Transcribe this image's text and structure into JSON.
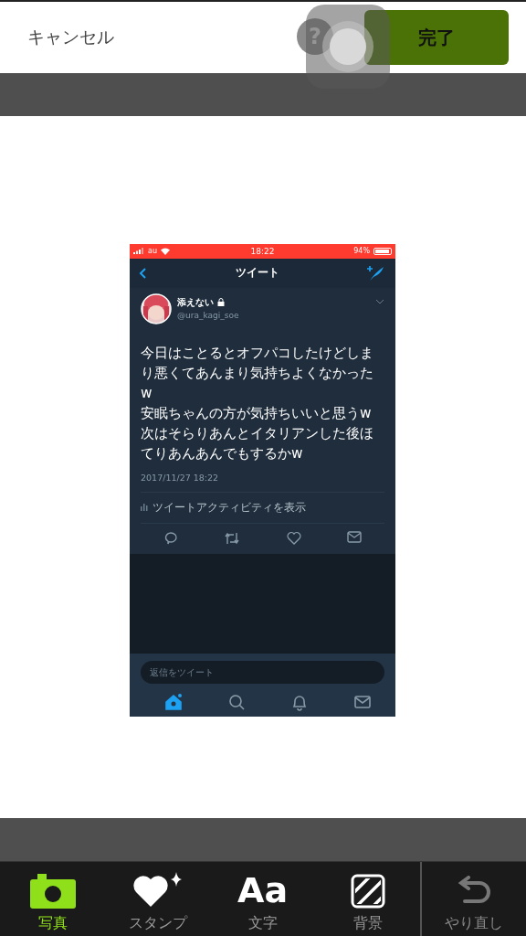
{
  "top_bar": {
    "cancel": "キャンセル",
    "help": "?",
    "done": "完了"
  },
  "screenshot": {
    "status_bar": {
      "carrier": "au",
      "time": "18:22",
      "battery": "94%"
    },
    "nav": {
      "title": "ツイート"
    },
    "tweet": {
      "name": "添えない",
      "locked": true,
      "handle": "@ura_kagi_soe",
      "text": "今日はことるとオフパコしたけどしまり悪くてあんまり気持ちよくなかったw\n安眠ちゃんの方が気持ちいいと思うw\n次はそらりあんとイタリアンした後ほてりあんあんでもするかw",
      "timestamp": "2017/11/27 18:22",
      "activity": "ツイートアクティビティを表示"
    },
    "reply": {
      "placeholder": "返信をツイート"
    },
    "tabs": [
      {
        "kind": "home",
        "selected": true
      },
      {
        "kind": "search",
        "selected": false
      },
      {
        "kind": "bell",
        "selected": false
      },
      {
        "kind": "mail",
        "selected": false
      }
    ]
  },
  "toolbar": {
    "items": [
      {
        "kind": "camera",
        "label": "写真",
        "selected": true,
        "disabled": false
      },
      {
        "kind": "stamp",
        "label": "スタンプ",
        "selected": false,
        "disabled": false
      },
      {
        "kind": "text",
        "glyph": "Aa",
        "label": "文字",
        "selected": false,
        "disabled": false
      },
      {
        "kind": "background",
        "label": "背景",
        "selected": false,
        "disabled": false
      },
      {
        "kind": "undo",
        "label": "やり直し",
        "selected": false,
        "disabled": true
      }
    ]
  }
}
